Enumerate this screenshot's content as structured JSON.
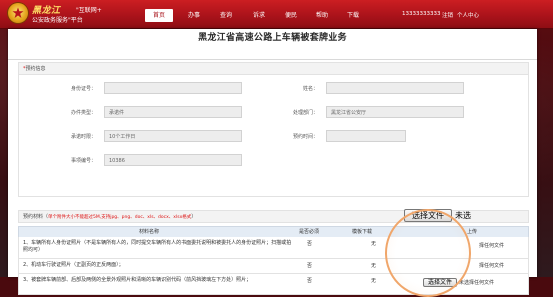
{
  "header": {
    "logo_cn": "黑龙江",
    "logo_highlight": "\"互联网+",
    "logo_subtitle": "公安政务服务\"平台",
    "nav": [
      {
        "label": "首页",
        "active": true
      },
      {
        "label": "办事",
        "active": false
      },
      {
        "label": "查询",
        "active": false
      },
      {
        "label": "诉求",
        "active": false
      },
      {
        "label": "便民",
        "active": false
      },
      {
        "label": "帮助",
        "active": false
      },
      {
        "label": "下载",
        "active": false
      }
    ],
    "phone": "13333333333",
    "logout_label": "注销",
    "my_center_label": "个人中心"
  },
  "page": {
    "title": "黑龙江省高速公路上车辆被套牌业务"
  },
  "appointment": {
    "section_star": "*",
    "section_title": "预约信息",
    "fields": {
      "id_card": {
        "label": "身份证号：",
        "value": ""
      },
      "name": {
        "label": "姓名：",
        "value": ""
      },
      "handle_type": {
        "label": "办件类型：",
        "value": "承诺件"
      },
      "department": {
        "label": "处理部门：",
        "value": "黑龙江省公安厅"
      },
      "commit_time": {
        "label": "承诺时限：",
        "value": "10个工作日"
      },
      "appointment_time": {
        "label": "预约时间：",
        "value": ""
      },
      "case_no": {
        "label": "事项编号：",
        "value": "10386"
      }
    }
  },
  "materials": {
    "section_title": "预约材料（",
    "note": "单个附件大小不能超过5M,支持jpg、png、doc、xls、docx、xlsx格式",
    "section_close": "）",
    "columns": {
      "name": "材料名称",
      "required": "是否必须",
      "template": "模板下载",
      "upload": "上传"
    },
    "rows": [
      {
        "name": "1、车辆所有人身份证照片（不是车辆所有人的，同时提交车辆所有人的书面委托说明和被委托人的身份证照片；扫描或拍照均可）",
        "required": "否",
        "template": "无",
        "button": "选择文件",
        "tail": "未选",
        "status": "择任何文件"
      },
      {
        "name": "2、机动车行驶证照片（正副页的正反两面）；",
        "required": "否",
        "template": "无",
        "status": "择任何文件"
      },
      {
        "name": "3、被套牌车辆前部、后部及两侧的全景外观照片和清晰的车辆识别代码（前风挡玻璃左下方处）照片；",
        "required": "否",
        "template": "无",
        "button": "选择文件",
        "status": "未选择任何文件"
      }
    ]
  }
}
